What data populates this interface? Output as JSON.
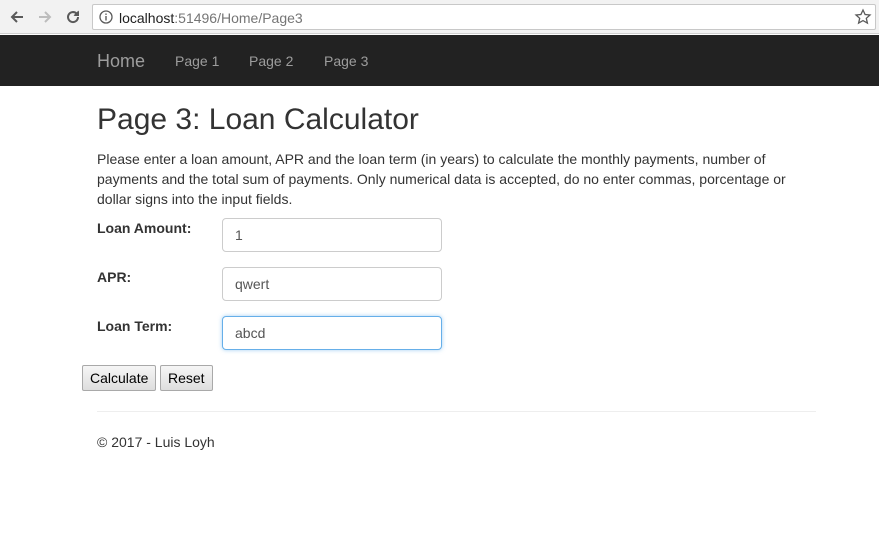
{
  "browser": {
    "url_host": "localhost",
    "url_rest": ":51496/Home/Page3"
  },
  "navbar": {
    "brand": "Home",
    "links": [
      "Page 1",
      "Page 2",
      "Page 3"
    ]
  },
  "main": {
    "title": "Page 3: Loan Calculator",
    "intro": "Please enter a loan amount, APR and the loan term (in years) to calculate the monthly payments, number of payments and the total sum of payments. Only numerical data is accepted, do no enter commas, porcentage or dollar signs into the input fields.",
    "fields": [
      {
        "label": "Loan Amount:",
        "value": "1"
      },
      {
        "label": "APR:",
        "value": "qwert"
      },
      {
        "label": "Loan Term:",
        "value": "abcd"
      }
    ],
    "buttons": {
      "calculate": "Calculate",
      "reset": "Reset"
    }
  },
  "footer": {
    "text": "© 2017 - Luis Loyh"
  },
  "colors": {
    "navbar_bg": "#222222",
    "navbar_text": "#9d9d9d",
    "focus_border": "#66afe9"
  }
}
